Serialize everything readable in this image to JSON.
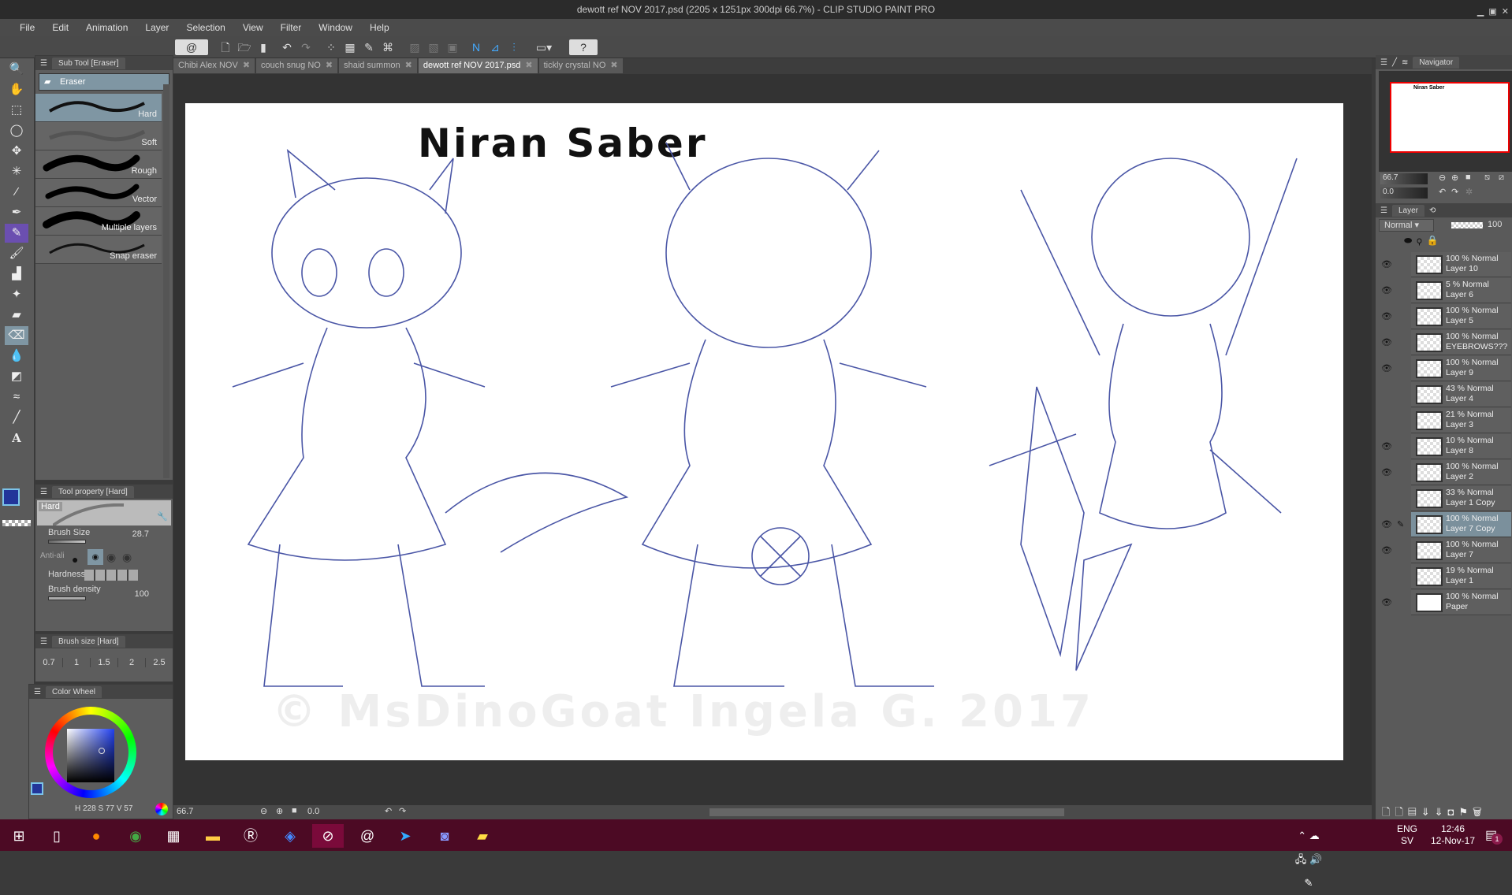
{
  "window": {
    "title": "dewott ref NOV 2017.psd (2205 x 1251px 300dpi 66.7%) - CLIP STUDIO PAINT PRO"
  },
  "menu": [
    "File",
    "Edit",
    "Animation",
    "Layer",
    "Selection",
    "View",
    "Filter",
    "Window",
    "Help"
  ],
  "doc_tabs": [
    {
      "label": "Chibi Alex NOV"
    },
    {
      "label": "couch snug NO"
    },
    {
      "label": "shaid summon"
    },
    {
      "label": "dewott ref NOV 2017.psd"
    },
    {
      "label": "tickly crystal NO"
    }
  ],
  "subtool": {
    "title": "Sub Tool [Eraser]",
    "group": "Eraser",
    "items": [
      "Hard",
      "Soft",
      "Rough",
      "Vector",
      "Multiple layers",
      "Snap eraser"
    ]
  },
  "tool_property": {
    "title": "Tool property [Hard]",
    "preview_label": "Hard",
    "brush_size_label": "Brush Size",
    "brush_size": "28.7",
    "antialias_label": "Anti-ali",
    "hardness_label": "Hardness",
    "density_label": "Brush density",
    "density": "100"
  },
  "brush_size_panel": {
    "title": "Brush size [Hard]",
    "sizes": [
      "0.7",
      "1",
      "1.5",
      "2",
      "2.5"
    ]
  },
  "color_wheel": {
    "title": "Color Wheel",
    "h": "228",
    "s": "77",
    "v": "57",
    "main_color": "#22359a",
    "sub_color": "#ffffff"
  },
  "canvas": {
    "heading": "Niran Saber",
    "watermark": "© MsDinoGoat Ingela G. 2017"
  },
  "status": {
    "zoom": "66.7",
    "angle": "0.0"
  },
  "navigator": {
    "title": "Navigator",
    "zoom": "66.7",
    "angle": "0.0",
    "thumb_heading": "Niran Saber"
  },
  "layer_panel": {
    "title": "Layer",
    "blend": "Normal",
    "opacity": "100",
    "layers": [
      {
        "opacity": "100 % Normal",
        "name": "Layer 10",
        "visible": true
      },
      {
        "opacity": "5 % Normal",
        "name": "Layer 6",
        "visible": true
      },
      {
        "opacity": "100 % Normal",
        "name": "Layer 5",
        "visible": true
      },
      {
        "opacity": "100 % Normal",
        "name": "EYEBROWS???",
        "visible": true
      },
      {
        "opacity": "100 % Normal",
        "name": "Layer 9",
        "visible": true
      },
      {
        "opacity": "43 % Normal",
        "name": "Layer 4",
        "visible": false
      },
      {
        "opacity": "21 % Normal",
        "name": "Layer 3",
        "visible": false
      },
      {
        "opacity": "10 % Normal",
        "name": "Layer 8",
        "visible": true
      },
      {
        "opacity": "100 % Normal",
        "name": "Layer 2",
        "visible": true
      },
      {
        "opacity": "33 % Normal",
        "name": "Layer 1 Copy",
        "visible": false
      },
      {
        "opacity": "100 % Normal",
        "name": "Layer 7 Copy",
        "visible": true,
        "selected": true
      },
      {
        "opacity": "100 % Normal",
        "name": "Layer 7",
        "visible": true
      },
      {
        "opacity": "19 % Normal",
        "name": "Layer 1",
        "visible": false
      },
      {
        "opacity": "100 % Normal",
        "name": "Paper",
        "visible": true
      }
    ]
  },
  "taskbar": {
    "lang": "ENG",
    "layout": "SV",
    "time": "12:46",
    "date": "12-Nov-17",
    "notifications": "1"
  }
}
